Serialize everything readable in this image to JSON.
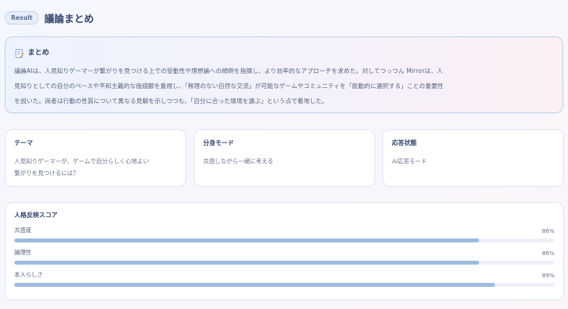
{
  "header": {
    "badge": "Result",
    "title": "議論まとめ"
  },
  "summary": {
    "icon": "memo-icon",
    "title": "まとめ",
    "lines": [
      "議論AIは、人見知りゲーマーが繋がりを見つける上での受動性や理想論への傾倒を指摘し、より効率的なアプローチを求めた。対してつっつん Mirrorは、人",
      "見知りとしての自分のペースや平和主義的な価値観を重視し、「無理のない自然な交流」が可能なゲームやコミュニティを「能動的に選択する」ことの重要性",
      "を説いた。両者は行動の性質について異なる見解を示しつつも、「自分に合った環境を選ぶ」という点で着地した。"
    ]
  },
  "cards": [
    {
      "title": "テーマ",
      "lines": [
        "人見知りゲーマーが、ゲームで自分らしく心地よい",
        "繋がりを見つけるには？"
      ]
    },
    {
      "title": "分身モード",
      "lines": [
        "共感しながら一緒に考える"
      ]
    },
    {
      "title": "応答状態",
      "lines": [
        "AI応答モード"
      ]
    }
  ],
  "scores": {
    "title": "人格反映スコア",
    "items": [
      {
        "label": "共感度",
        "value_text": "86%",
        "percent": 86
      },
      {
        "label": "論理性",
        "value_text": "86%",
        "percent": 86
      },
      {
        "label": "本人らしさ",
        "value_text": "89%",
        "percent": 89
      }
    ]
  },
  "colors": {
    "accent_bar": "#9dbce0",
    "summary_border": "#bcd0ec",
    "title_text": "#34456a"
  }
}
